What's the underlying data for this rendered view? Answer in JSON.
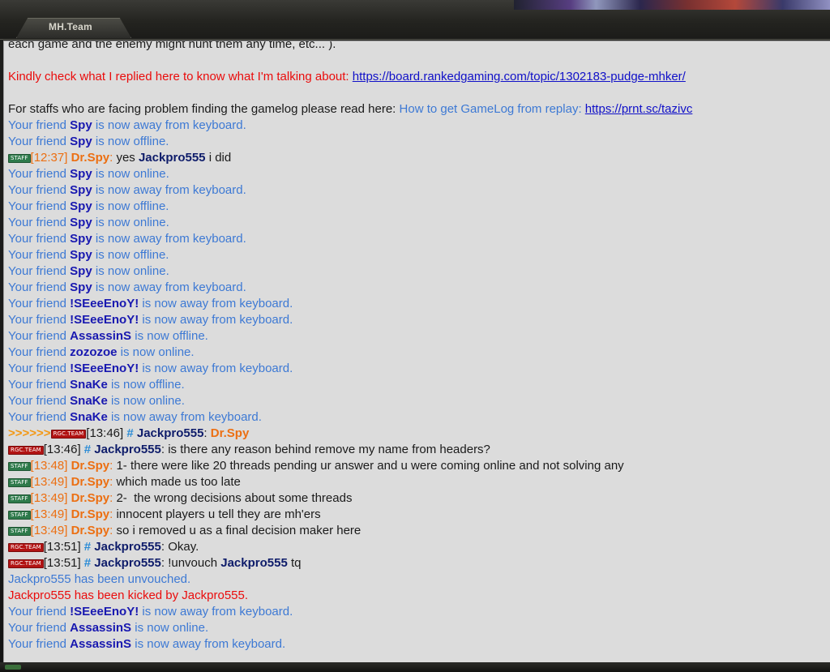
{
  "window": {
    "title": "MH.Team"
  },
  "colors": {
    "panel_bg": "#dcdcdc",
    "system_message": "#3d79d4",
    "alert_red": "#ea0c0c",
    "staff_orange": "#ec6f12",
    "team_navy": "#0e1c6a",
    "hash_blue": "#2c8cd6",
    "staff_badge": "#2e7a4b",
    "rgc_badge": "#b21313"
  },
  "badges": {
    "staff": "STAFF",
    "rgc_team": "RGC.TEAM"
  },
  "chat": {
    "intro": {
      "line1": "each game and the enemy might hunt them any time, etc... ).",
      "kindly_text": "Kindly check what I replied here to know what I'm talking about: ",
      "kindly_link": "https://board.rankedgaming.com/topic/1302183-pudge-mhker/",
      "staffs_text": "For staffs who are facing problem finding the gamelog please read here: ",
      "howto_text": "How to get GameLog from replay: ",
      "howto_link": "https://prnt.sc/tazivc"
    },
    "friend_prefix": "Your friend ",
    "friend_events": {
      "away": " is now away from keyboard.",
      "offline": " is now offline.",
      "online": " is now online."
    },
    "names": {
      "spy": "Spy",
      "iseeenoy": "!SEeeEnoY!",
      "assassins": "AssassinS",
      "zozozoe": "zozozoe",
      "snake": "SnaKe",
      "drspy": "Dr.Spy",
      "jackpro": "Jackpro555"
    },
    "misc": {
      "colon": ":",
      "hash": "#",
      "arrows": ">>>>>>"
    },
    "messages": {
      "t1237": "[12:37]",
      "m1237": " yes ",
      "m1237b": " i did",
      "t1346a": "[13:46]",
      "t1346b": "[13:46]",
      "m1346b": " is there any reason behind remove my name from headers?",
      "t1348": "[13:48]",
      "m1348": " 1- there were like 20 threads pending ur answer and u were coming online and not solving any",
      "t1349a": "[13:49]",
      "m1349a": " which made us too late",
      "t1349b": "[13:49]",
      "m1349b": " 2-  the wrong decisions about some threads",
      "t1349c": "[13:49]",
      "m1349c": " innocent players u tell they are mh'ers",
      "t1349d": "[13:49]",
      "m1349d": " so i removed u as a final decision maker here",
      "t1351a": "[13:51]",
      "m1351a": " Okay.",
      "t1351b": "[13:51]",
      "m1351b": " !unvouch ",
      "m1351c": " tq",
      "unvouched": "Jackpro555 has been unvouched.",
      "kicked": "Jackpro555 has been kicked by Jackpro555."
    }
  }
}
